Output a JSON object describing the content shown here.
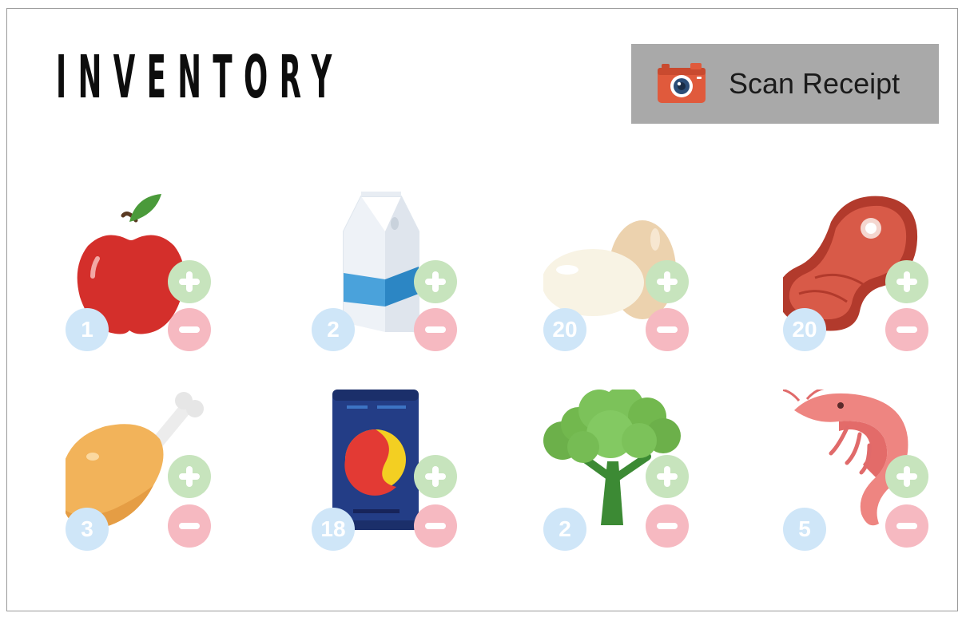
{
  "title": "INVENTORY",
  "scan_button": {
    "label": "Scan Receipt",
    "icon": "camera-icon"
  },
  "colors": {
    "scan_bg": "#a9a9a9",
    "badge": "#cfe6f8",
    "plus": "#c7e4bd",
    "minus": "#f6b9c1"
  },
  "items": [
    {
      "name": "apple",
      "icon": "apple-icon",
      "count": "1"
    },
    {
      "name": "milk",
      "icon": "milk-carton-icon",
      "count": "2"
    },
    {
      "name": "eggs",
      "icon": "eggs-icon",
      "count": "20"
    },
    {
      "name": "steak",
      "icon": "steak-icon",
      "count": "20"
    },
    {
      "name": "chicken",
      "icon": "chicken-leg-icon",
      "count": "3"
    },
    {
      "name": "soda",
      "icon": "soda-can-icon",
      "count": "18"
    },
    {
      "name": "broccoli",
      "icon": "broccoli-icon",
      "count": "2"
    },
    {
      "name": "shrimp",
      "icon": "shrimp-icon",
      "count": "5"
    }
  ]
}
